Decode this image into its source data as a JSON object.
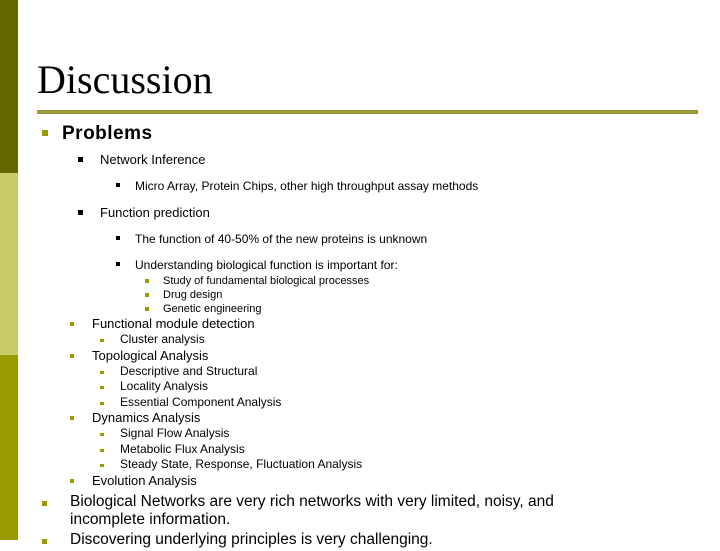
{
  "slide": {
    "title": "Discussion",
    "colors": {
      "bar_top": "#666600",
      "bar_middle": "#c9cc66",
      "bar_bottom": "#999900",
      "rule": "#999933",
      "bullet_olive": "#999900",
      "bullet_black": "#000000",
      "text": "#000000",
      "background": "#ffffff"
    },
    "outline": {
      "heading": "Problems",
      "network_inference": "Network Inference",
      "network_inference_detail": "Micro Array, Protein Chips, other high throughput assay methods",
      "function_prediction": "Function prediction",
      "function_unknown": "The function of 40-50% of the new proteins is unknown",
      "understanding": "Understanding biological function is important for:",
      "understanding_items": [
        "Study of fundamental biological processes",
        "Drug design",
        "Genetic engineering"
      ],
      "functional_module_detection": "Functional module detection",
      "functional_module_items": [
        "Cluster analysis"
      ],
      "topological_analysis": "Topological Analysis",
      "topological_items": [
        "Descriptive and Structural",
        "Locality Analysis",
        "Essential Component Analysis"
      ],
      "dynamics_analysis": "Dynamics Analysis",
      "dynamics_items": [
        "Signal Flow Analysis",
        "Metabolic Flux Analysis",
        "Steady State, Response, Fluctuation Analysis"
      ],
      "evolution_analysis": "Evolution Analysis",
      "closing": [
        "Biological Networks are very rich networks with very limited, noisy, and incomplete information.",
        "Discovering underlying principles is very challenging."
      ]
    }
  }
}
